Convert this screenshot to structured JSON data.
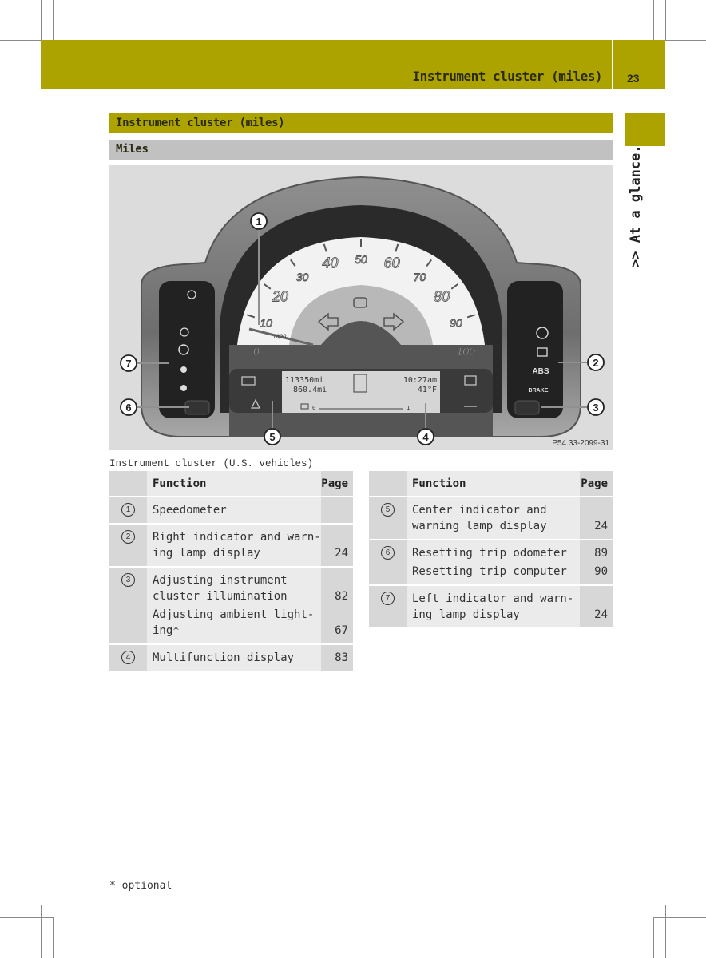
{
  "header": {
    "title": "Instrument cluster (miles)",
    "page_number": "23"
  },
  "side_tab": {
    "label": ">> At a glance."
  },
  "section": {
    "title": "Instrument cluster (miles)",
    "subtitle": "Miles"
  },
  "figure": {
    "figure_id": "P54.33-2099-31",
    "callouts": [
      "1",
      "2",
      "3",
      "4",
      "5",
      "6",
      "7"
    ],
    "speedometer": {
      "unit": "mph",
      "ticks": [
        "0",
        "10",
        "20",
        "30",
        "40",
        "50",
        "60",
        "70",
        "80",
        "90",
        "100"
      ]
    },
    "display": {
      "odometer": "113350mi",
      "trip": "860.4mi",
      "time": "10:27am",
      "temperature": "41°F",
      "gauge_min": "0",
      "gauge_max": "1"
    },
    "left_panel_icons": [
      "high-beam-icon",
      "low-beam-icon",
      "tire-pressure-icon",
      "seat-belt-icon",
      "airbag-icon"
    ],
    "right_panel_icons": [
      "steering-warning-icon",
      "engine-icon",
      "ABS",
      "BRAKE"
    ],
    "right_panel_text": {
      "abs": "ABS",
      "brake": "BRAKE"
    }
  },
  "caption": "Instrument cluster (U.S. vehicles)",
  "table_left": {
    "headers": {
      "num": "",
      "function": "Function",
      "page": "Page"
    },
    "rows": [
      {
        "num": "1",
        "items": [
          {
            "text": "Speedometer",
            "page": ""
          }
        ]
      },
      {
        "num": "2",
        "items": [
          {
            "text": "Right indicator and warn-\ning lamp display",
            "page": "24"
          }
        ]
      },
      {
        "num": "3",
        "items": [
          {
            "text": "Adjusting instrument\ncluster illumination",
            "page": "82"
          },
          {
            "text": "Adjusting ambient light-\ning*",
            "page": "67"
          }
        ]
      },
      {
        "num": "4",
        "items": [
          {
            "text": "Multifunction display",
            "page": "83"
          }
        ]
      }
    ]
  },
  "table_right": {
    "headers": {
      "num": "",
      "function": "Function",
      "page": "Page"
    },
    "rows": [
      {
        "num": "5",
        "items": [
          {
            "text": "Center indicator and\nwarning lamp display",
            "page": "24"
          }
        ]
      },
      {
        "num": "6",
        "items": [
          {
            "text": "Resetting trip odometer",
            "page": "89"
          },
          {
            "text": "Resetting trip computer",
            "page": "90"
          }
        ]
      },
      {
        "num": "7",
        "items": [
          {
            "text": "Left indicator and warn-\ning lamp display",
            "page": "24"
          }
        ]
      }
    ]
  },
  "footnote": "* optional"
}
